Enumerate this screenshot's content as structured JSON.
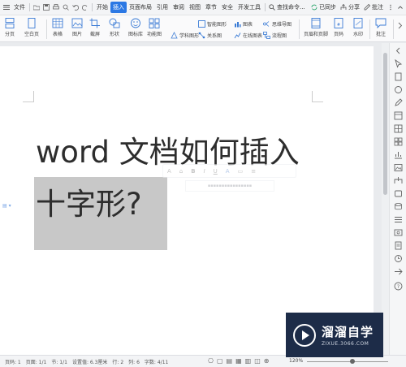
{
  "menu": {
    "file": "文件",
    "tabs": [
      "开始",
      "插入",
      "页面布局",
      "引用",
      "审阅",
      "视图",
      "章节",
      "安全",
      "开发工具"
    ],
    "active_tab": "插入",
    "search": "查找命令...",
    "synced": "已同步",
    "share": "分享",
    "comment": "批注"
  },
  "ribbon": {
    "page_break": "分页",
    "blank_page": "空白页",
    "table": "表格",
    "picture": "图片",
    "screenshot": "截屏",
    "shapes": "形状",
    "icon_lib": "图标库",
    "func_chart": "功能图",
    "smart_shape": "智能图形",
    "chart": "图表",
    "mind_map": "思维导图",
    "discipline_shape": "学科图形",
    "relation_chart": "关系图",
    "online_chart": "在线图表",
    "flow_chart": "流程图",
    "header_footer": "页眉和页脚",
    "page_number": "页码",
    "watermark": "水印",
    "annotation": "批注"
  },
  "document": {
    "line1": "word 文档如何插入",
    "line2": "十字形?"
  },
  "statusbar": {
    "page_num": "页码: 1",
    "page": "页面: 1/1",
    "section": "节: 1/1",
    "setting": "设置值: 6.3厘米",
    "row": "行: 2",
    "col": "列: 6",
    "words": "字数: 4/11",
    "zoom": "120%"
  },
  "watermark": {
    "title": "溜溜自学",
    "url": "ZIXUE.3066.COM"
  },
  "colors": {
    "accent": "#2b78e4",
    "selection": "#c8c8c8",
    "watermark_bg": "#1d2c48"
  }
}
